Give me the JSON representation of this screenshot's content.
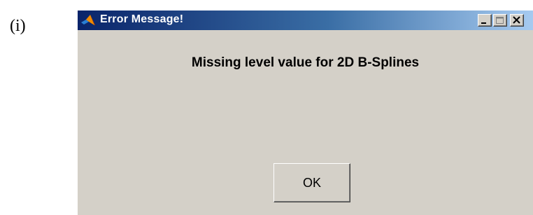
{
  "figure_label": "(i)",
  "window": {
    "title": "Error Message!",
    "app_icon": "matlab-logo-icon",
    "controls": {
      "minimize_icon": "minimize-icon",
      "maximize_icon": "maximize-icon",
      "close_icon": "close-icon"
    }
  },
  "dialog": {
    "message": "Missing level value for 2D B-Splines",
    "ok_label": "OK"
  },
  "colors": {
    "titlebar_start": "#0a246a",
    "titlebar_end": "#a6caf0",
    "dialog_background": "#d4d0c8"
  }
}
